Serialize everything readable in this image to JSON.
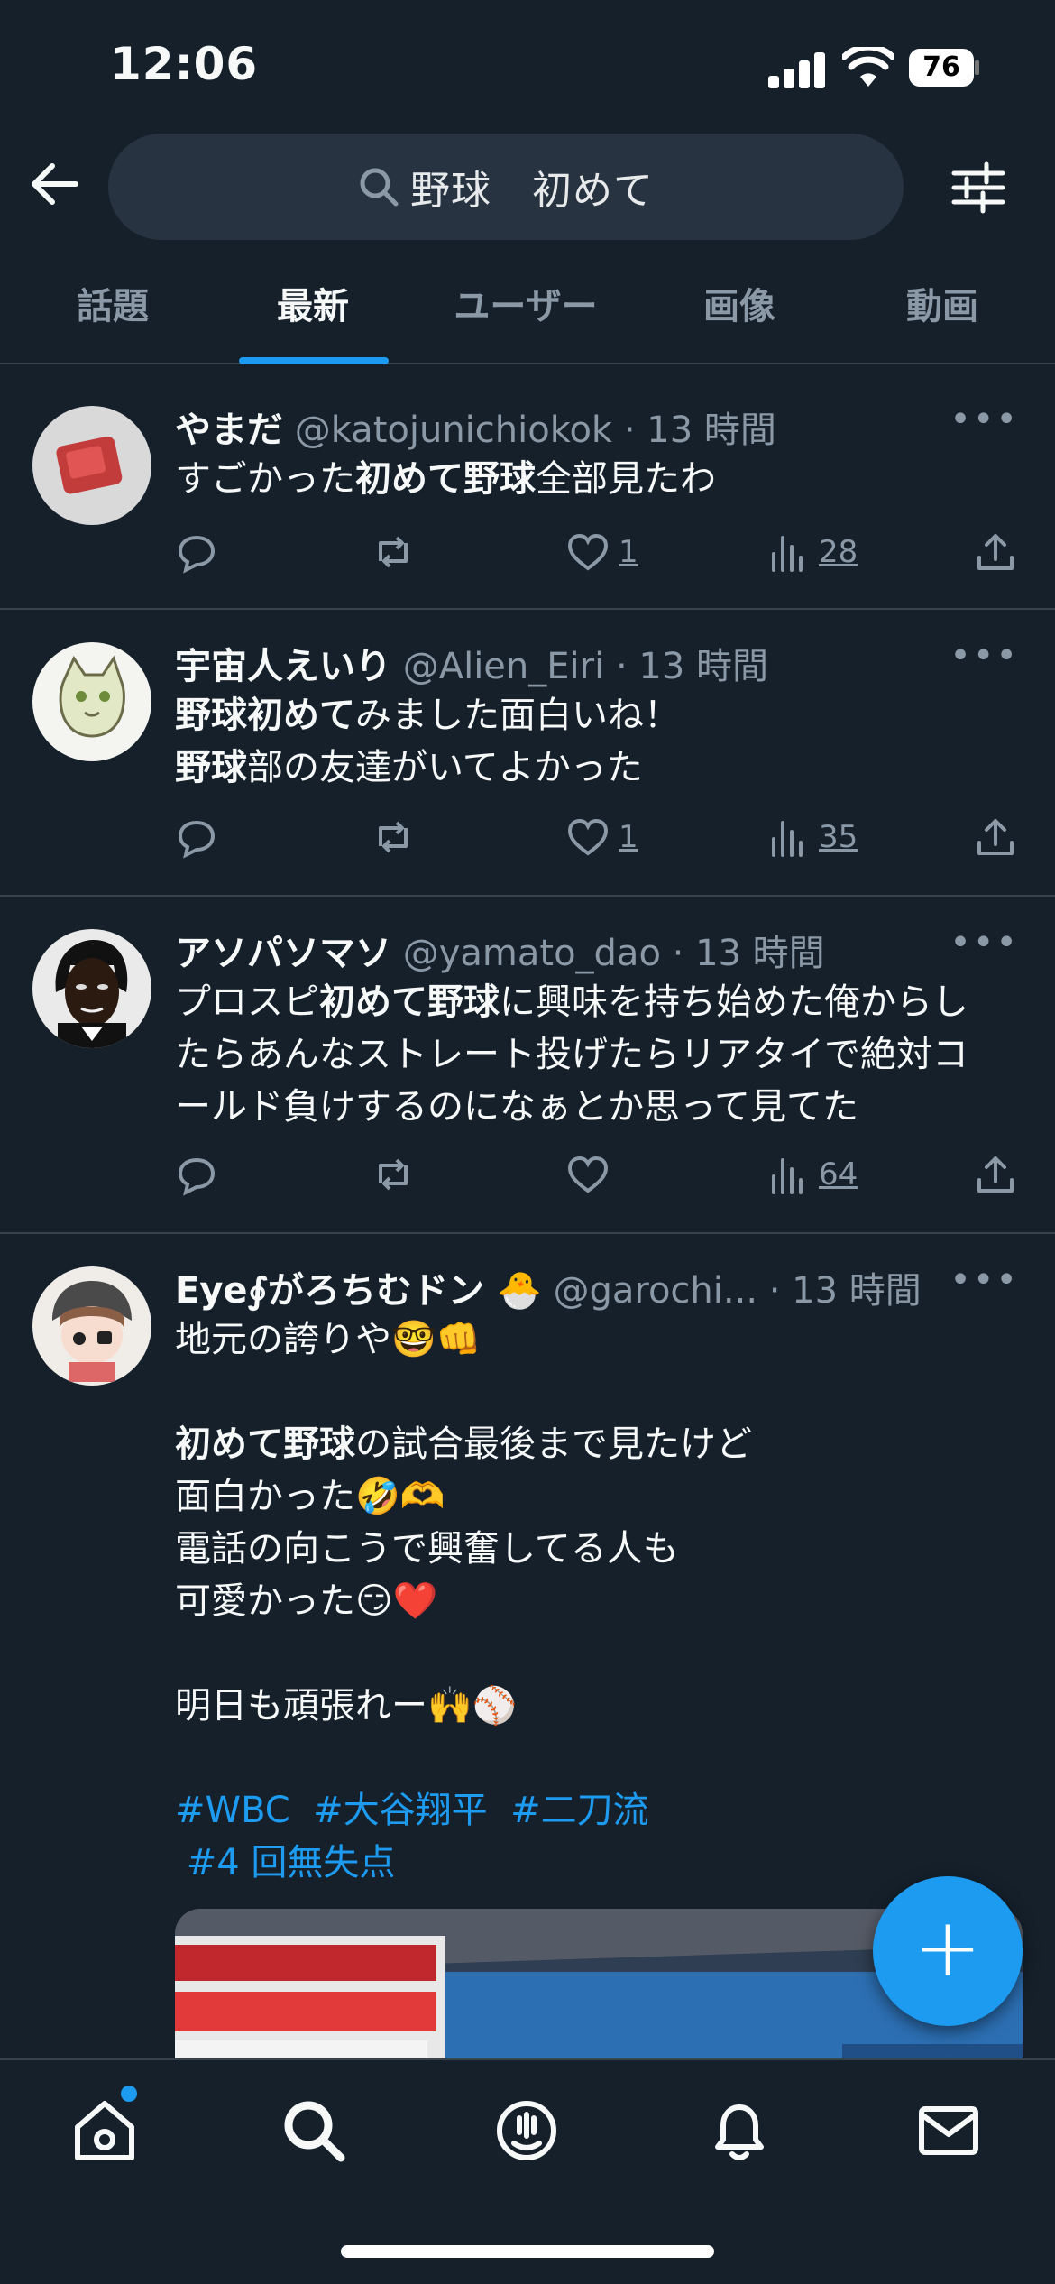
{
  "status": {
    "time": "12:06",
    "battery": "76"
  },
  "search": {
    "query": "野球　初めて"
  },
  "tabs": [
    {
      "label": "話題"
    },
    {
      "label": "最新"
    },
    {
      "label": "ユーザー"
    },
    {
      "label": "画像"
    },
    {
      "label": "動画"
    }
  ],
  "tweets": [
    {
      "name": "やまだ",
      "handle": "@katojunichiokok",
      "time": "· 13 時間",
      "lines": [
        "すごかった初めて野球全部見たわ"
      ],
      "likes": "1",
      "views": "28"
    },
    {
      "name": "宇宙人えいり",
      "handle": "@Alien_Eiri",
      "time": "· 13 時間",
      "lines": [
        "野球初めてみました面白いね！",
        "野球部の友達がいてよかった"
      ],
      "likes": "1",
      "views": "35"
    },
    {
      "name": "アソパソマソ",
      "handle": "@yamato_dao",
      "time": "· 13 時間",
      "lines": [
        "プロスピ初めて野球に興味を持ち始めた俺からし",
        "たらあんなストレート投げたらリアタイで絶対コ",
        "ールド負けするのになぁとか思って見てた"
      ],
      "likes": "",
      "views": "64"
    },
    {
      "name": "Eye∮がろちむドン",
      "handle": "@garochi...",
      "time": "· 13 時間",
      "lines": [
        "地元の誇りや🤓👊",
        "初めて野球の試合最後まで見たけど",
        "面白かった🤣🫶",
        "電話の向こうで興奮してる人も",
        "可愛かった😏❤️",
        "明日も頑張れー🙌⚾"
      ],
      "hashtags": [
        "#WBC",
        "#大谷翔平",
        "#二刀流",
        "#4 回無失点"
      ]
    }
  ],
  "fab": {
    "label": "+"
  }
}
